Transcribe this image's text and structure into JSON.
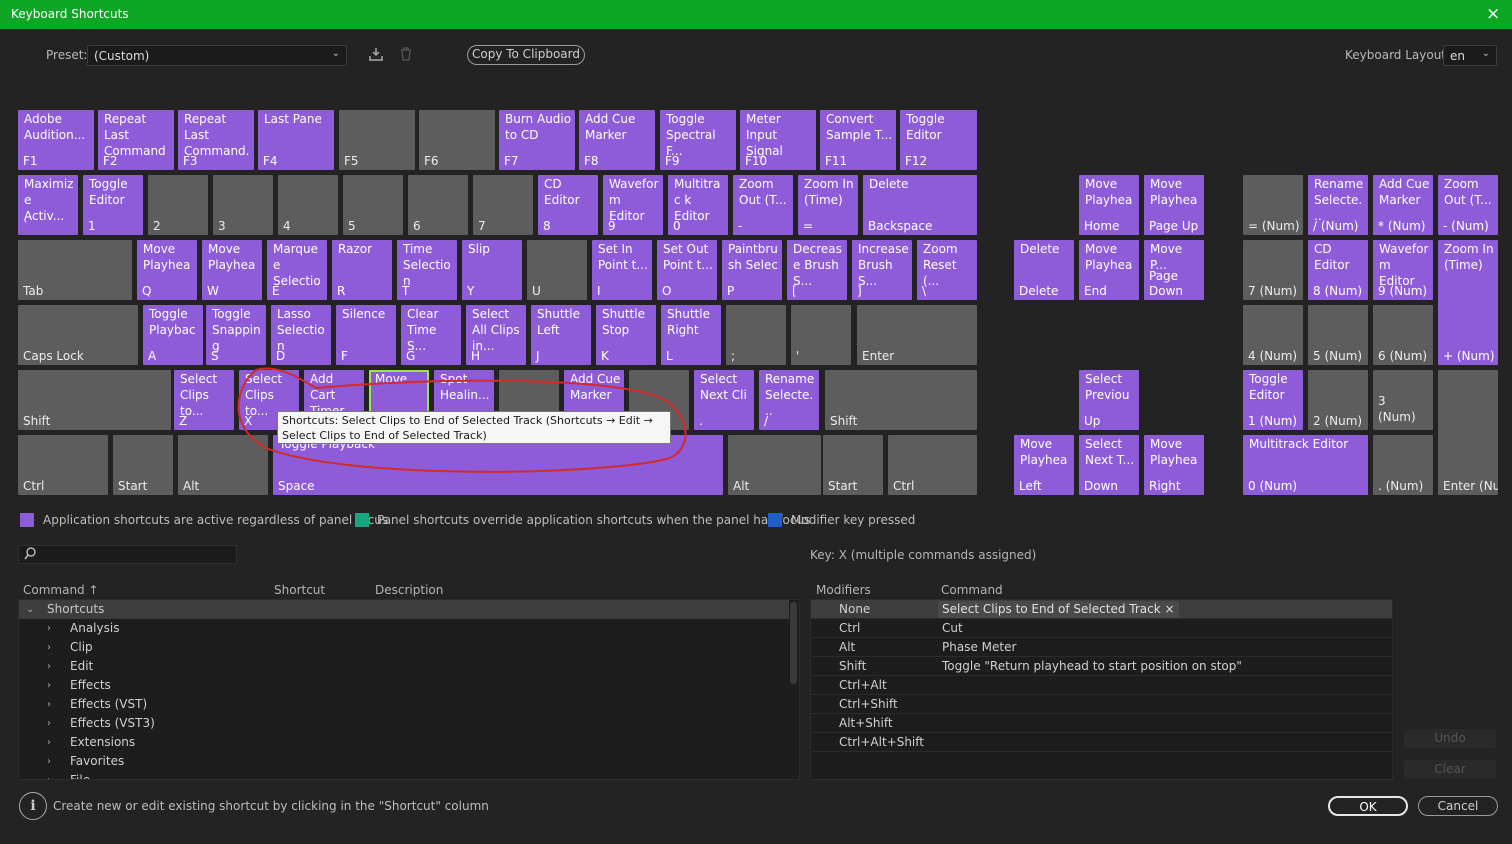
{
  "window": {
    "title": "Keyboard Shortcuts",
    "close_icon": "×"
  },
  "preset": {
    "label": "Preset:",
    "value": "(Custom)"
  },
  "toolbar": {
    "copy_label": "Copy To Clipboard"
  },
  "layout": {
    "label": "Keyboard Layout:",
    "value": "en"
  },
  "colors": {
    "application": "#8e5bd9",
    "panel": "#17a67f",
    "modifier": "#1d5fc9",
    "unassigned": "#5d5d5d",
    "selected_outline": "#9ae64a"
  },
  "keys": [
    {
      "cmd": "Adobe Audition...",
      "label": "F1",
      "t": "p"
    },
    {
      "cmd": "Repeat Last Command",
      "label": "F2",
      "t": "p"
    },
    {
      "cmd": "Repeat Last Command...",
      "label": "F3",
      "t": "p"
    },
    {
      "cmd": "Last Pane",
      "label": "F4",
      "t": "p"
    },
    {
      "cmd": "",
      "label": "F5",
      "t": "g"
    },
    {
      "cmd": "",
      "label": "F6",
      "t": "g"
    },
    {
      "cmd": "Burn Audio to CD",
      "label": "F7",
      "t": "p"
    },
    {
      "cmd": "Add Cue Marker",
      "label": "F8",
      "t": "p"
    },
    {
      "cmd": "Toggle Spectral F...",
      "label": "F9",
      "t": "p"
    },
    {
      "cmd": "Meter Input Signal",
      "label": "F10",
      "t": "p"
    },
    {
      "cmd": "Convert Sample T...",
      "label": "F11",
      "t": "p"
    },
    {
      "cmd": "Toggle Editor",
      "label": "F12",
      "t": "p"
    },
    {
      "cmd": "Maximiz e Activ...",
      "label": "`",
      "t": "p"
    },
    {
      "cmd": "Toggle Editor",
      "label": "1",
      "t": "p"
    },
    {
      "cmd": "",
      "label": "2",
      "t": "g"
    },
    {
      "cmd": "",
      "label": "3",
      "t": "g"
    },
    {
      "cmd": "",
      "label": "4",
      "t": "g"
    },
    {
      "cmd": "",
      "label": "5",
      "t": "g"
    },
    {
      "cmd": "",
      "label": "6",
      "t": "g"
    },
    {
      "cmd": "",
      "label": "7",
      "t": "g"
    },
    {
      "cmd": "CD Editor",
      "label": "8",
      "t": "p"
    },
    {
      "cmd": "Wavefor m Editor",
      "label": "9",
      "t": "p"
    },
    {
      "cmd": "Multitrac k Editor",
      "label": "0",
      "t": "p"
    },
    {
      "cmd": "Zoom Out (T...",
      "label": "-",
      "t": "p"
    },
    {
      "cmd": "Zoom In (Time)",
      "label": "=",
      "t": "p"
    },
    {
      "cmd": "Delete",
      "label": "Backspace",
      "t": "p"
    },
    {
      "cmd": "",
      "label": "Tab",
      "t": "g"
    },
    {
      "cmd": "Move Playhea",
      "label": "Q",
      "t": "p"
    },
    {
      "cmd": "Move Playhea",
      "label": "W",
      "t": "p"
    },
    {
      "cmd": "Marquee Selection",
      "label": "E",
      "t": "p"
    },
    {
      "cmd": "Razor",
      "label": "R",
      "t": "p"
    },
    {
      "cmd": "Time Selection",
      "label": "T",
      "t": "p"
    },
    {
      "cmd": "Slip",
      "label": "Y",
      "t": "p"
    },
    {
      "cmd": "",
      "label": "U",
      "t": "g"
    },
    {
      "cmd": "Set In Point t...",
      "label": "I",
      "t": "p"
    },
    {
      "cmd": "Set Out Point t...",
      "label": "O",
      "t": "p"
    },
    {
      "cmd": "Paintbru sh Selec",
      "label": "P",
      "t": "p"
    },
    {
      "cmd": "Decrease Brush S...",
      "label": "[",
      "t": "p"
    },
    {
      "cmd": "Increase Brush S...",
      "label": "]",
      "t": "p"
    },
    {
      "cmd": "Zoom Reset (...",
      "label": "\\",
      "t": "p"
    },
    {
      "cmd": "",
      "label": "Caps Lock",
      "t": "g"
    },
    {
      "cmd": "Toggle Playbac",
      "label": "A",
      "t": "p"
    },
    {
      "cmd": "Toggle Snapping",
      "label": "S",
      "t": "p"
    },
    {
      "cmd": "Lasso Selection",
      "label": "D",
      "t": "p"
    },
    {
      "cmd": "Silence",
      "label": "F",
      "t": "p"
    },
    {
      "cmd": "Clear Time S...",
      "label": "G",
      "t": "p"
    },
    {
      "cmd": "Select All Clips in...",
      "label": "H",
      "t": "p"
    },
    {
      "cmd": "Shuttle Left",
      "label": "J",
      "t": "p"
    },
    {
      "cmd": "Shuttle Stop",
      "label": "K",
      "t": "p"
    },
    {
      "cmd": "Shuttle Right",
      "label": "L",
      "t": "p"
    },
    {
      "cmd": "",
      "label": ";",
      "t": "g"
    },
    {
      "cmd": "",
      "label": "'",
      "t": "g"
    },
    {
      "cmd": "",
      "label": "Enter",
      "t": "g"
    },
    {
      "cmd": "",
      "label": "Shift",
      "t": "g"
    },
    {
      "cmd": "Select Clips to...",
      "label": "Z",
      "t": "p"
    },
    {
      "cmd": "Select Clips to...",
      "label": "X",
      "t": "p"
    },
    {
      "cmd": "Add Cart Timer...",
      "label": "C",
      "t": "p"
    },
    {
      "cmd": "Move",
      "label": "V",
      "t": "p"
    },
    {
      "cmd": "Spot Healin...",
      "label": "B",
      "t": "p"
    },
    {
      "cmd": "",
      "label": "N",
      "t": "g"
    },
    {
      "cmd": "Add Cue Marker",
      "label": "M",
      "t": "p"
    },
    {
      "cmd": "",
      "label": ",",
      "t": "g"
    },
    {
      "cmd": "Select Next Cli",
      "label": ".",
      "t": "p"
    },
    {
      "cmd": "Rename Selecte...",
      "label": "/",
      "t": "p"
    },
    {
      "cmd": "",
      "label": "Shift",
      "t": "g"
    },
    {
      "cmd": "",
      "label": "Ctrl",
      "t": "g"
    },
    {
      "cmd": "",
      "label": "Start",
      "t": "g"
    },
    {
      "cmd": "",
      "label": "Alt",
      "t": "g"
    },
    {
      "cmd": "Toggle Playback",
      "label": "Space",
      "t": "p"
    },
    {
      "cmd": "",
      "label": "Alt",
      "t": "g"
    },
    {
      "cmd": "",
      "label": "Start",
      "t": "g"
    },
    {
      "cmd": "",
      "label": "Ctrl",
      "t": "g"
    },
    {
      "cmd": "Move Playhea",
      "label": "Home",
      "t": "p"
    },
    {
      "cmd": "Move Playhea",
      "label": "Page Up",
      "t": "p"
    },
    {
      "cmd": "Delete",
      "label": "Delete",
      "t": "p"
    },
    {
      "cmd": "Move Playhea",
      "label": "End",
      "t": "p"
    },
    {
      "cmd": "Move P...",
      "label": "Page Down",
      "t": "p"
    },
    {
      "cmd": "Select Previou",
      "label": "Up",
      "t": "p"
    },
    {
      "cmd": "Move Playhea",
      "label": "Left",
      "t": "p"
    },
    {
      "cmd": "Select Next T...",
      "label": "Down",
      "t": "p"
    },
    {
      "cmd": "Move Playhea",
      "label": "Right",
      "t": "p"
    },
    {
      "cmd": "",
      "label": "= (Num)",
      "t": "g"
    },
    {
      "cmd": "Rename Selecte...",
      "label": "/ (Num)",
      "t": "p"
    },
    {
      "cmd": "Add Cue Marker",
      "label": "* (Num)",
      "t": "p"
    },
    {
      "cmd": "Zoom Out (T...",
      "label": "- (Num)",
      "t": "p"
    },
    {
      "cmd": "",
      "label": "7 (Num)",
      "t": "g"
    },
    {
      "cmd": "CD Editor",
      "label": "8 (Num)",
      "t": "p"
    },
    {
      "cmd": "Wavefor m Editor",
      "label": "9 (Num)",
      "t": "p"
    },
    {
      "cmd": "Zoom In (Time)",
      "label": "+ (Num)",
      "t": "p"
    },
    {
      "cmd": "",
      "label": "4 (Num)",
      "t": "g"
    },
    {
      "cmd": "",
      "label": "5 (Num)",
      "t": "g"
    },
    {
      "cmd": "",
      "label": "6 (Num)",
      "t": "g"
    },
    {
      "cmd": "Toggle Editor",
      "label": "1 (Num)",
      "t": "p"
    },
    {
      "cmd": "",
      "label": "2 (Num)",
      "t": "g"
    },
    {
      "cmd": "",
      "label": "3 (Num)",
      "t": "g"
    },
    {
      "cmd": "Multitrack Editor",
      "label": "0 (Num)",
      "t": "p"
    },
    {
      "cmd": "",
      "label": ". (Num)",
      "t": "g"
    },
    {
      "cmd": "",
      "label": "Enter (Num)",
      "t": "g"
    }
  ],
  "tooltip": {
    "text": "Shortcuts: Select Clips to End of Selected Track (Shortcuts → Edit → Select Clips to End of Selected Track)"
  },
  "legend": {
    "application": "Application shortcuts are active regardless of panel focus",
    "panel": "Panel shortcuts override application shortcuts when the panel has focus",
    "modifier": "Modifier key pressed"
  },
  "search": {
    "placeholder": "",
    "icon": "search-icon"
  },
  "command_table": {
    "headers": {
      "command": "Command ↑",
      "shortcut": "Shortcut",
      "description": "Description"
    },
    "root": "Shortcuts",
    "items": [
      "Analysis",
      "Clip",
      "Edit",
      "Effects",
      "Effects (VST)",
      "Effects (VST3)",
      "Extensions",
      "Favorites",
      "File"
    ]
  },
  "key_info": "Key:  X (multiple commands assigned)",
  "modifier_table": {
    "headers": {
      "modifiers": "Modifiers",
      "command": "Command"
    },
    "rows": [
      {
        "mod": "None",
        "cmd": "Select Clips to End of Selected Track",
        "remove": "×"
      },
      {
        "mod": "Ctrl",
        "cmd": "Cut"
      },
      {
        "mod": "Alt",
        "cmd": "Phase Meter"
      },
      {
        "mod": "Shift",
        "cmd": "Toggle \"Return playhead to start position on stop\""
      },
      {
        "mod": "Ctrl+Alt",
        "cmd": ""
      },
      {
        "mod": "Ctrl+Shift",
        "cmd": ""
      },
      {
        "mod": "Alt+Shift",
        "cmd": ""
      },
      {
        "mod": "Ctrl+Alt+Shift",
        "cmd": ""
      }
    ]
  },
  "side_buttons": {
    "undo": "Undo",
    "clear": "Clear"
  },
  "footer": {
    "info_icon": "i",
    "hint": "Create new or edit existing shortcut by clicking in the \"Shortcut\" column",
    "ok": "OK",
    "cancel": "Cancel"
  }
}
